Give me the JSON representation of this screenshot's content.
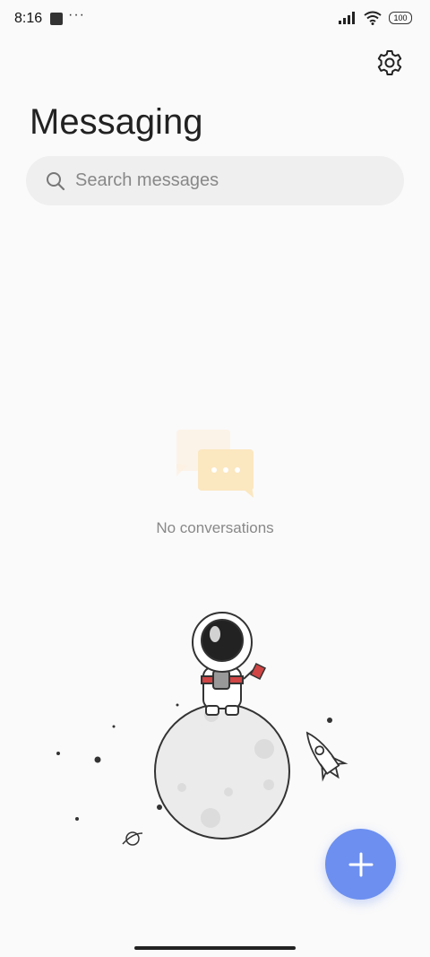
{
  "status_bar": {
    "time": "8:16",
    "more": "···",
    "battery": "100"
  },
  "header": {
    "title": "Messaging"
  },
  "search": {
    "placeholder": "Search messages"
  },
  "empty_state": {
    "text": "No conversations"
  },
  "icons": {
    "settings": "gear-icon",
    "search": "search-icon",
    "compose": "plus-icon",
    "empty": "chat-bubbles-icon"
  },
  "colors": {
    "accent": "#6c8ff0",
    "background": "#fafafa",
    "search_bg": "#efefef"
  }
}
